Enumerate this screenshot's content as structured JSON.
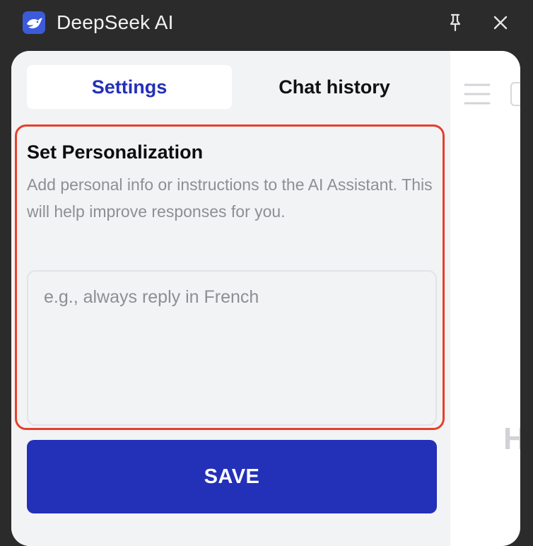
{
  "window": {
    "title": "DeepSeek AI",
    "logo_icon": "deepseek-whale-logo",
    "pin_icon": "pin-icon",
    "close_icon": "close-icon"
  },
  "tabs": [
    {
      "label": "Settings",
      "active": true
    },
    {
      "label": "Chat history",
      "active": false
    }
  ],
  "personalization": {
    "heading": "Set Personalization",
    "description": "Add personal info or instructions to the AI Assistant. This will help improve responses for you.",
    "input_value": "",
    "input_placeholder": "e.g., always reply in French"
  },
  "save_label": "SAVE",
  "side_panel": {
    "menu_icon": "hamburger-menu-icon",
    "partial_letter": "H"
  },
  "colors": {
    "accent": "#2330b8",
    "highlight_border": "#e5402c",
    "titlebar_bg": "#2b2b2b",
    "panel_bg": "#f2f3f5",
    "muted_text": "#8d8f94"
  }
}
